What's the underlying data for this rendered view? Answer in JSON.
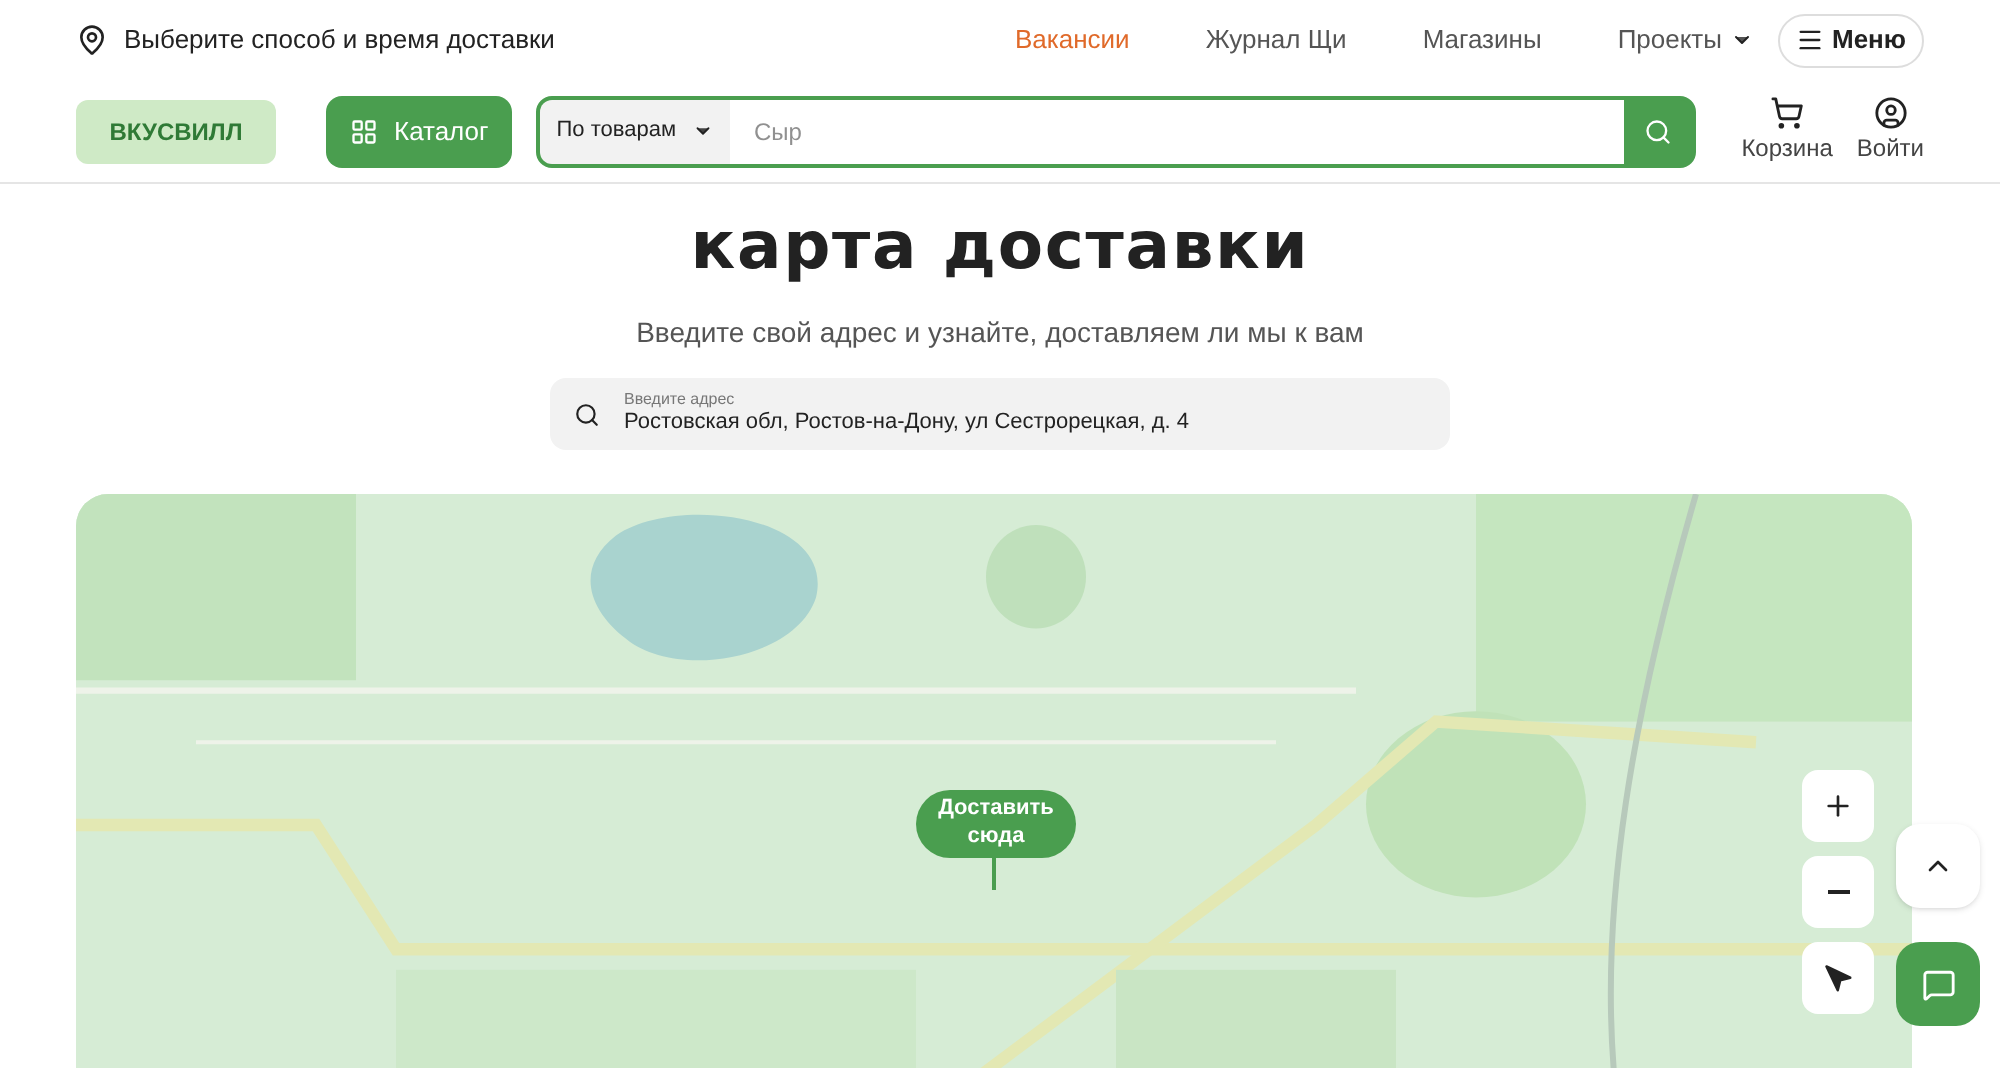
{
  "topbar": {
    "delivery_label": "Выберите способ и время доставки",
    "links": [
      {
        "label": "Вакансии",
        "highlighted": true
      },
      {
        "label": "Журнал Щи",
        "highlighted": false
      },
      {
        "label": "Магазины",
        "highlighted": false
      }
    ],
    "projects": "Проекты",
    "menu": "Меню"
  },
  "header": {
    "logo": "ВКУСВИЛЛ",
    "catalog": "Каталог",
    "search_scope": "По товарам",
    "search_placeholder": "Сыр",
    "cart": "Корзина",
    "login": "Войти"
  },
  "page": {
    "title": "карта доставки",
    "subtitle": "Введите свой адрес и узнайте, доставляем ли мы к вам",
    "address_label": "Введите адрес",
    "address_value": "Ростовская обл, Ростов-на-Дону, ул Сестрорецкая, д. 4"
  },
  "map": {
    "kind": "picture",
    "pin_label": "Доставить сюда"
  }
}
